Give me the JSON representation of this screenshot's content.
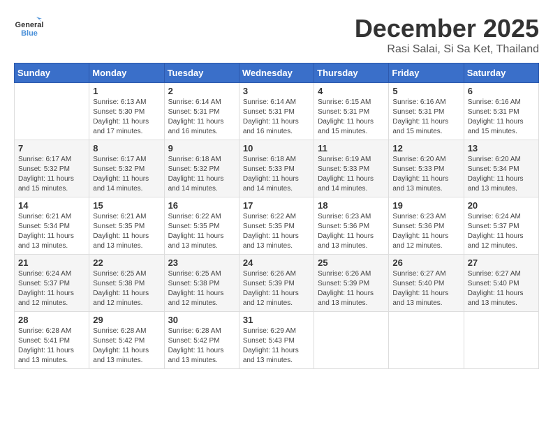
{
  "logo": {
    "general": "General",
    "blue": "Blue"
  },
  "title": {
    "month": "December 2025",
    "location": "Rasi Salai, Si Sa Ket, Thailand"
  },
  "headers": [
    "Sunday",
    "Monday",
    "Tuesday",
    "Wednesday",
    "Thursday",
    "Friday",
    "Saturday"
  ],
  "weeks": [
    [
      {
        "day": "",
        "info": ""
      },
      {
        "day": "1",
        "info": "Sunrise: 6:13 AM\nSunset: 5:30 PM\nDaylight: 11 hours\nand 17 minutes."
      },
      {
        "day": "2",
        "info": "Sunrise: 6:14 AM\nSunset: 5:31 PM\nDaylight: 11 hours\nand 16 minutes."
      },
      {
        "day": "3",
        "info": "Sunrise: 6:14 AM\nSunset: 5:31 PM\nDaylight: 11 hours\nand 16 minutes."
      },
      {
        "day": "4",
        "info": "Sunrise: 6:15 AM\nSunset: 5:31 PM\nDaylight: 11 hours\nand 15 minutes."
      },
      {
        "day": "5",
        "info": "Sunrise: 6:16 AM\nSunset: 5:31 PM\nDaylight: 11 hours\nand 15 minutes."
      },
      {
        "day": "6",
        "info": "Sunrise: 6:16 AM\nSunset: 5:31 PM\nDaylight: 11 hours\nand 15 minutes."
      }
    ],
    [
      {
        "day": "7",
        "info": "Sunrise: 6:17 AM\nSunset: 5:32 PM\nDaylight: 11 hours\nand 15 minutes."
      },
      {
        "day": "8",
        "info": "Sunrise: 6:17 AM\nSunset: 5:32 PM\nDaylight: 11 hours\nand 14 minutes."
      },
      {
        "day": "9",
        "info": "Sunrise: 6:18 AM\nSunset: 5:32 PM\nDaylight: 11 hours\nand 14 minutes."
      },
      {
        "day": "10",
        "info": "Sunrise: 6:18 AM\nSunset: 5:33 PM\nDaylight: 11 hours\nand 14 minutes."
      },
      {
        "day": "11",
        "info": "Sunrise: 6:19 AM\nSunset: 5:33 PM\nDaylight: 11 hours\nand 14 minutes."
      },
      {
        "day": "12",
        "info": "Sunrise: 6:20 AM\nSunset: 5:33 PM\nDaylight: 11 hours\nand 13 minutes."
      },
      {
        "day": "13",
        "info": "Sunrise: 6:20 AM\nSunset: 5:34 PM\nDaylight: 11 hours\nand 13 minutes."
      }
    ],
    [
      {
        "day": "14",
        "info": "Sunrise: 6:21 AM\nSunset: 5:34 PM\nDaylight: 11 hours\nand 13 minutes."
      },
      {
        "day": "15",
        "info": "Sunrise: 6:21 AM\nSunset: 5:35 PM\nDaylight: 11 hours\nand 13 minutes."
      },
      {
        "day": "16",
        "info": "Sunrise: 6:22 AM\nSunset: 5:35 PM\nDaylight: 11 hours\nand 13 minutes."
      },
      {
        "day": "17",
        "info": "Sunrise: 6:22 AM\nSunset: 5:35 PM\nDaylight: 11 hours\nand 13 minutes."
      },
      {
        "day": "18",
        "info": "Sunrise: 6:23 AM\nSunset: 5:36 PM\nDaylight: 11 hours\nand 13 minutes."
      },
      {
        "day": "19",
        "info": "Sunrise: 6:23 AM\nSunset: 5:36 PM\nDaylight: 11 hours\nand 12 minutes."
      },
      {
        "day": "20",
        "info": "Sunrise: 6:24 AM\nSunset: 5:37 PM\nDaylight: 11 hours\nand 12 minutes."
      }
    ],
    [
      {
        "day": "21",
        "info": "Sunrise: 6:24 AM\nSunset: 5:37 PM\nDaylight: 11 hours\nand 12 minutes."
      },
      {
        "day": "22",
        "info": "Sunrise: 6:25 AM\nSunset: 5:38 PM\nDaylight: 11 hours\nand 12 minutes."
      },
      {
        "day": "23",
        "info": "Sunrise: 6:25 AM\nSunset: 5:38 PM\nDaylight: 11 hours\nand 12 minutes."
      },
      {
        "day": "24",
        "info": "Sunrise: 6:26 AM\nSunset: 5:39 PM\nDaylight: 11 hours\nand 12 minutes."
      },
      {
        "day": "25",
        "info": "Sunrise: 6:26 AM\nSunset: 5:39 PM\nDaylight: 11 hours\nand 13 minutes."
      },
      {
        "day": "26",
        "info": "Sunrise: 6:27 AM\nSunset: 5:40 PM\nDaylight: 11 hours\nand 13 minutes."
      },
      {
        "day": "27",
        "info": "Sunrise: 6:27 AM\nSunset: 5:40 PM\nDaylight: 11 hours\nand 13 minutes."
      }
    ],
    [
      {
        "day": "28",
        "info": "Sunrise: 6:28 AM\nSunset: 5:41 PM\nDaylight: 11 hours\nand 13 minutes."
      },
      {
        "day": "29",
        "info": "Sunrise: 6:28 AM\nSunset: 5:42 PM\nDaylight: 11 hours\nand 13 minutes."
      },
      {
        "day": "30",
        "info": "Sunrise: 6:28 AM\nSunset: 5:42 PM\nDaylight: 11 hours\nand 13 minutes."
      },
      {
        "day": "31",
        "info": "Sunrise: 6:29 AM\nSunset: 5:43 PM\nDaylight: 11 hours\nand 13 minutes."
      },
      {
        "day": "",
        "info": ""
      },
      {
        "day": "",
        "info": ""
      },
      {
        "day": "",
        "info": ""
      }
    ]
  ]
}
